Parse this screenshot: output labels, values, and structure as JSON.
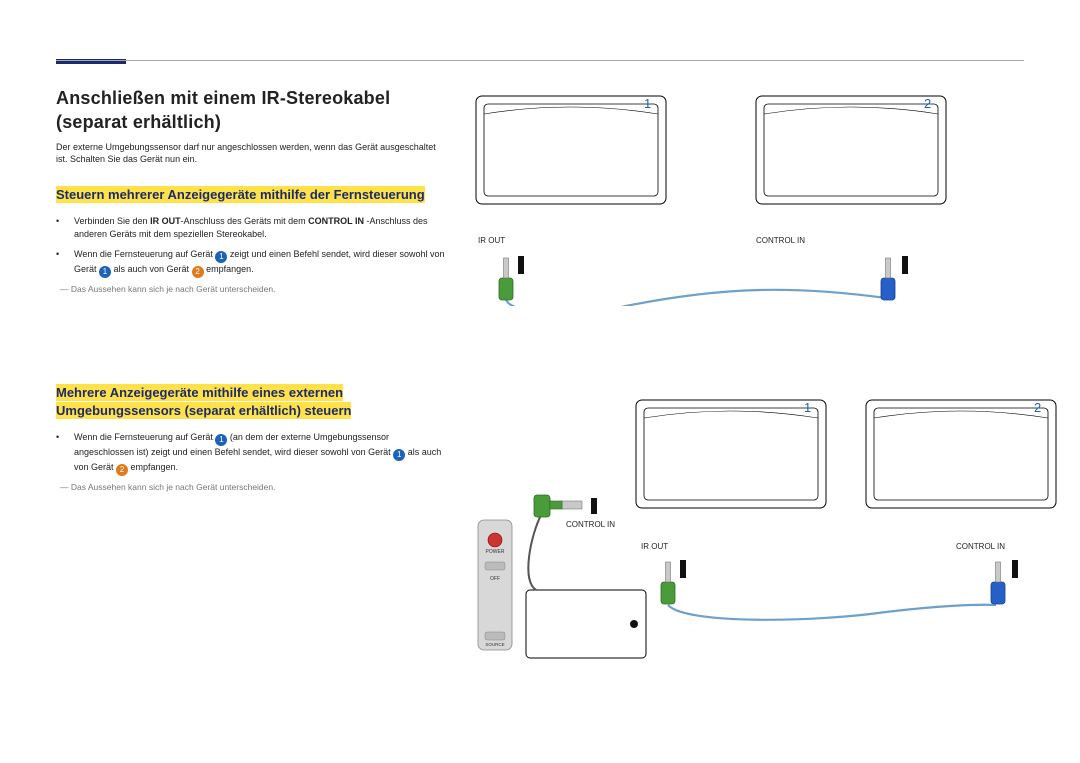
{
  "title_line1": "Anschließen mit einem IR-Stereokabel",
  "title_line2": "(separat erhältlich)",
  "intro": "Der externe Umgebungssensor darf nur angeschlossen werden, wenn das Gerät ausgeschaltet ist.  Schalten Sie das Gerät nun ein.",
  "section1_heading": "Steuern mehrerer Anzeigegeräte mithilfe der Fernsteuerung",
  "s1_b1_prefix": "Verbinden Sie den ",
  "s1_b1_bold1": "IR OUT",
  "s1_b1_mid": "-Anschluss des Geräts mit dem ",
  "s1_b1_bold2": "CONTROL IN",
  "s1_b1_suffix": " -Anschluss des anderen Geräts mit dem speziellen Stereokabel.",
  "s1_b2_a": "Wenn die Fernsteuerung auf Gerät ",
  "s1_b2_b": " zeigt und einen Befehl sendet, wird dieser sowohl von Gerät ",
  "s1_b2_c": " als auch von Gerät ",
  "s1_b2_d": " empfangen.",
  "note_text": "Das Aussehen kann sich je nach Gerät unterscheiden.",
  "section2_line1": "Mehrere Anzeigegeräte mithilfe eines externen",
  "section2_line2": "Umgebungssensors (separat erhältlich) steuern",
  "s2_b1_a": "Wenn die Fernsteuerung auf Gerät ",
  "s2_b1_b": " (an dem der externe Umgebungssensor angeschlossen ist) zeigt und einen Befehl sendet, wird dieser sowohl von Gerät ",
  "s2_b1_c": " als auch von Gerät ",
  "s2_b1_d": " empfangen.",
  "bullet_dot": "•",
  "n1": "1",
  "n2": "2",
  "lbl_ir_out": "IR OUT",
  "lbl_control_in": "CONTROL IN",
  "remote_power": "POWER",
  "remote_off": "OFF",
  "remote_source": "SOURCE"
}
